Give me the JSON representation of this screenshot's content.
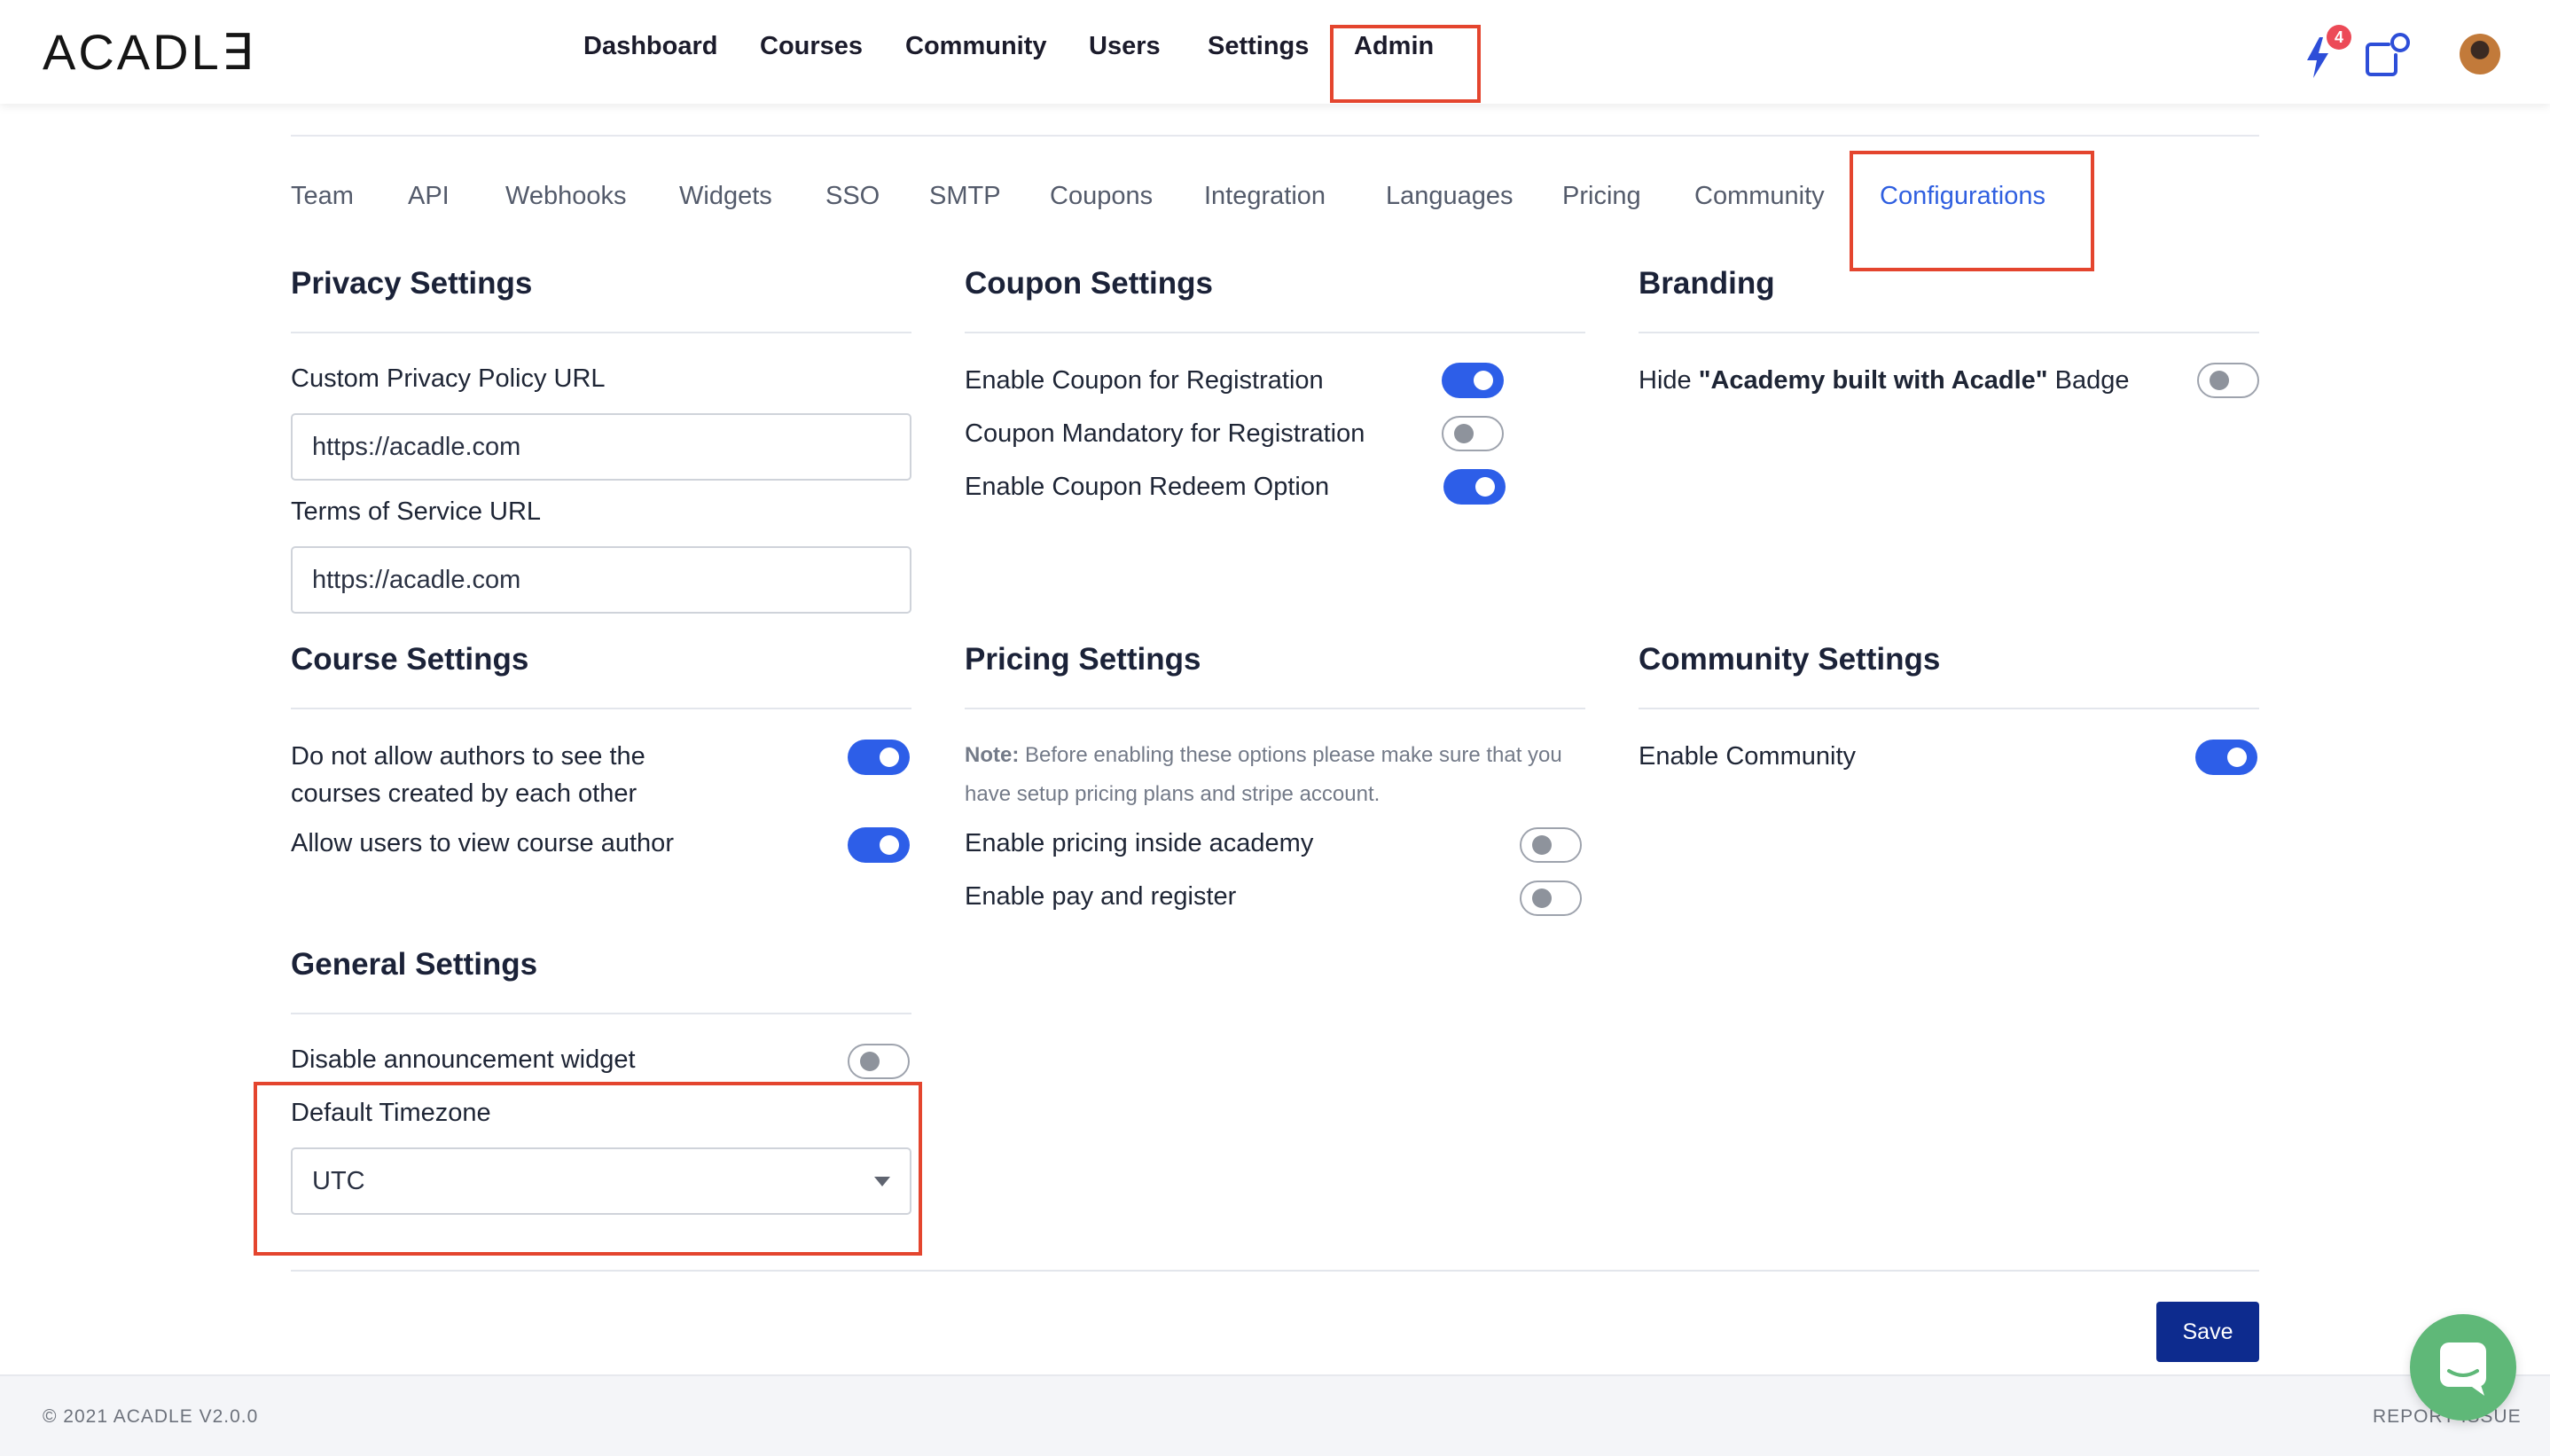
{
  "brand": {
    "logo_text": "ACADL∃"
  },
  "nav": {
    "items": [
      "Dashboard",
      "Courses",
      "Community",
      "Users",
      "Settings",
      "Admin"
    ],
    "active": "Admin",
    "notification_count": "4"
  },
  "tabs": {
    "items": [
      "Team",
      "API",
      "Webhooks",
      "Widgets",
      "SSO",
      "SMTP",
      "Coupons",
      "Integration",
      "Languages",
      "Pricing",
      "Community",
      "Configurations"
    ],
    "active": "Configurations"
  },
  "privacy": {
    "title": "Privacy Settings",
    "privacy_label": "Custom Privacy Policy URL",
    "privacy_value": "https://acadle.com",
    "terms_label": "Terms of Service URL",
    "terms_value": "https://acadle.com"
  },
  "coupon": {
    "title": "Coupon Settings",
    "options": [
      {
        "label": "Enable Coupon for Registration",
        "enabled": true
      },
      {
        "label": "Coupon Mandatory for Registration",
        "enabled": false
      },
      {
        "label": "Enable Coupon Redeem Option",
        "enabled": true
      }
    ]
  },
  "branding": {
    "title": "Branding",
    "hide_prefix": "Hide ",
    "hide_bold": "\"Academy built with Acadle\"",
    "hide_suffix": " Badge",
    "enabled": false
  },
  "course": {
    "title": "Course Settings",
    "options": [
      {
        "label_line1": "Do not allow authors to see the",
        "label_line2": "courses created by each other",
        "enabled": true
      },
      {
        "label": "Allow users to view course author",
        "enabled": true
      }
    ]
  },
  "pricing": {
    "title": "Pricing Settings",
    "note_label": "Note:",
    "note_line1": " Before enabling these options please make sure that you",
    "note_line2": "have setup pricing plans and stripe account.",
    "options": [
      {
        "label": "Enable pricing inside academy",
        "enabled": false
      },
      {
        "label": "Enable pay and register",
        "enabled": false
      }
    ]
  },
  "community": {
    "title": "Community Settings",
    "options": [
      {
        "label": "Enable Community",
        "enabled": true
      }
    ]
  },
  "general": {
    "title": "General Settings",
    "announcement_label": "Disable announcement widget",
    "announcement_enabled": false,
    "timezone_label": "Default Timezone",
    "timezone_value": "UTC"
  },
  "actions": {
    "save_label": "Save"
  },
  "footer": {
    "copyright": "© 2021 ACADLE V2.0.0",
    "report": "REPORT ISSUE"
  },
  "colors": {
    "accent": "#2d5ee8",
    "highlight": "#e4452e",
    "save": "#0d2b8e",
    "chat": "#5fb878"
  },
  "icons": {
    "notifications": "lightning-icon",
    "share": "share-box-icon",
    "chat": "chat-icon",
    "dropdown": "caret-down-icon"
  }
}
